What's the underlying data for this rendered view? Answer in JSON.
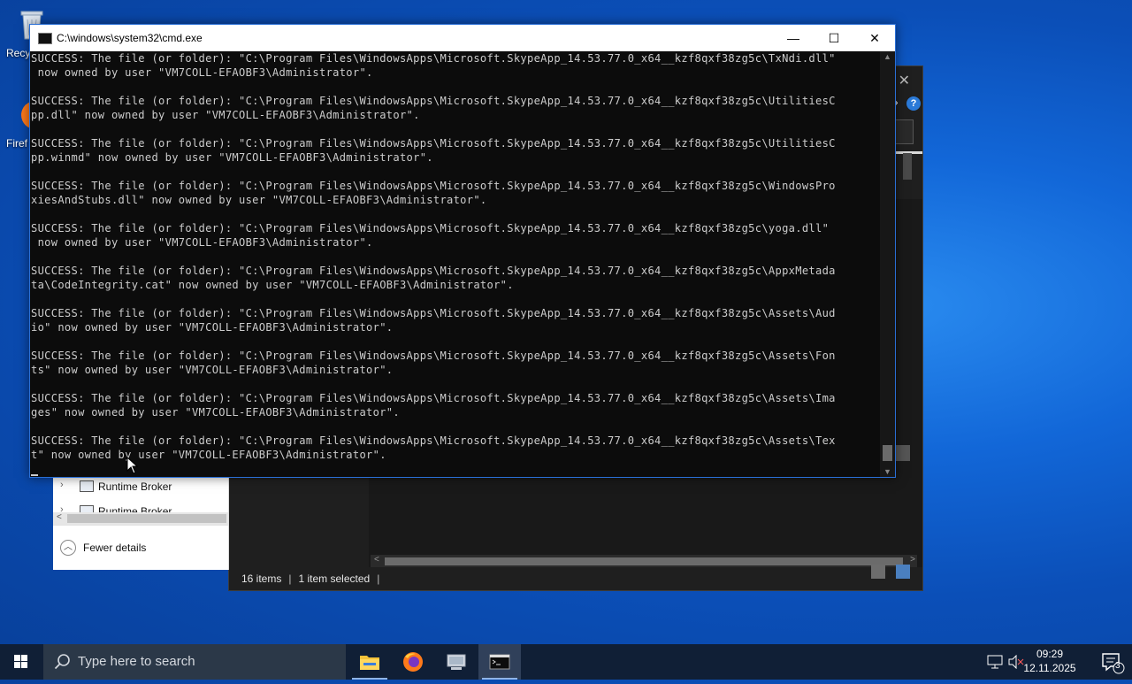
{
  "desktop": {
    "icons": [
      {
        "label": "Recy",
        "icon": "recycle-bin-icon"
      },
      {
        "label": "Firef",
        "icon": "firefox-icon"
      }
    ]
  },
  "cmd": {
    "title": "C:\\windows\\system32\\cmd.exe",
    "lines": [
      "SUCCESS: The file (or folder): \"C:\\Program Files\\WindowsApps\\Microsoft.SkypeApp_14.53.77.0_x64__kzf8qxf38zg5c\\TxNdi.dll\"",
      " now owned by user \"VM7COLL-EFAOBF3\\Administrator\".",
      "",
      "SUCCESS: The file (or folder): \"C:\\Program Files\\WindowsApps\\Microsoft.SkypeApp_14.53.77.0_x64__kzf8qxf38zg5c\\UtilitiesC",
      "pp.dll\" now owned by user \"VM7COLL-EFAOBF3\\Administrator\".",
      "",
      "SUCCESS: The file (or folder): \"C:\\Program Files\\WindowsApps\\Microsoft.SkypeApp_14.53.77.0_x64__kzf8qxf38zg5c\\UtilitiesC",
      "pp.winmd\" now owned by user \"VM7COLL-EFAOBF3\\Administrator\".",
      "",
      "SUCCESS: The file (or folder): \"C:\\Program Files\\WindowsApps\\Microsoft.SkypeApp_14.53.77.0_x64__kzf8qxf38zg5c\\WindowsPro",
      "xiesAndStubs.dll\" now owned by user \"VM7COLL-EFAOBF3\\Administrator\".",
      "",
      "SUCCESS: The file (or folder): \"C:\\Program Files\\WindowsApps\\Microsoft.SkypeApp_14.53.77.0_x64__kzf8qxf38zg5c\\yoga.dll\"",
      " now owned by user \"VM7COLL-EFAOBF3\\Administrator\".",
      "",
      "SUCCESS: The file (or folder): \"C:\\Program Files\\WindowsApps\\Microsoft.SkypeApp_14.53.77.0_x64__kzf8qxf38zg5c\\AppxMetada",
      "ta\\CodeIntegrity.cat\" now owned by user \"VM7COLL-EFAOBF3\\Administrator\".",
      "",
      "SUCCESS: The file (or folder): \"C:\\Program Files\\WindowsApps\\Microsoft.SkypeApp_14.53.77.0_x64__kzf8qxf38zg5c\\Assets\\Aud",
      "io\" now owned by user \"VM7COLL-EFAOBF3\\Administrator\".",
      "",
      "SUCCESS: The file (or folder): \"C:\\Program Files\\WindowsApps\\Microsoft.SkypeApp_14.53.77.0_x64__kzf8qxf38zg5c\\Assets\\Fon",
      "ts\" now owned by user \"VM7COLL-EFAOBF3\\Administrator\".",
      "",
      "SUCCESS: The file (or folder): \"C:\\Program Files\\WindowsApps\\Microsoft.SkypeApp_14.53.77.0_x64__kzf8qxf38zg5c\\Assets\\Ima",
      "ges\" now owned by user \"VM7COLL-EFAOBF3\\Administrator\".",
      "",
      "SUCCESS: The file (or folder): \"C:\\Program Files\\WindowsApps\\Microsoft.SkypeApp_14.53.77.0_x64__kzf8qxf38zg5c\\Assets\\Tex",
      "t\" now owned by user \"VM7COLL-EFAOBF3\\Administrator\"."
    ]
  },
  "taskmgr": {
    "rows": [
      {
        "label": "Runtime Broker"
      },
      {
        "label": "Runtime Broker"
      }
    ],
    "fewer_details": "Fewer details"
  },
  "explorer": {
    "status_items": "16 items",
    "status_selected": "1 item selected"
  },
  "taskbar": {
    "search_placeholder": "Type here to search",
    "time": "09:29",
    "date": "12.11.2025",
    "notification_count": "3",
    "apps": [
      "file-explorer-icon",
      "firefox-icon",
      "network-app-icon",
      "cmd-icon"
    ]
  },
  "colors": {
    "accent": "#2a6fd6",
    "console_bg": "#0c0c0c",
    "console_text": "#cccccc",
    "taskbar": "#101f36"
  }
}
